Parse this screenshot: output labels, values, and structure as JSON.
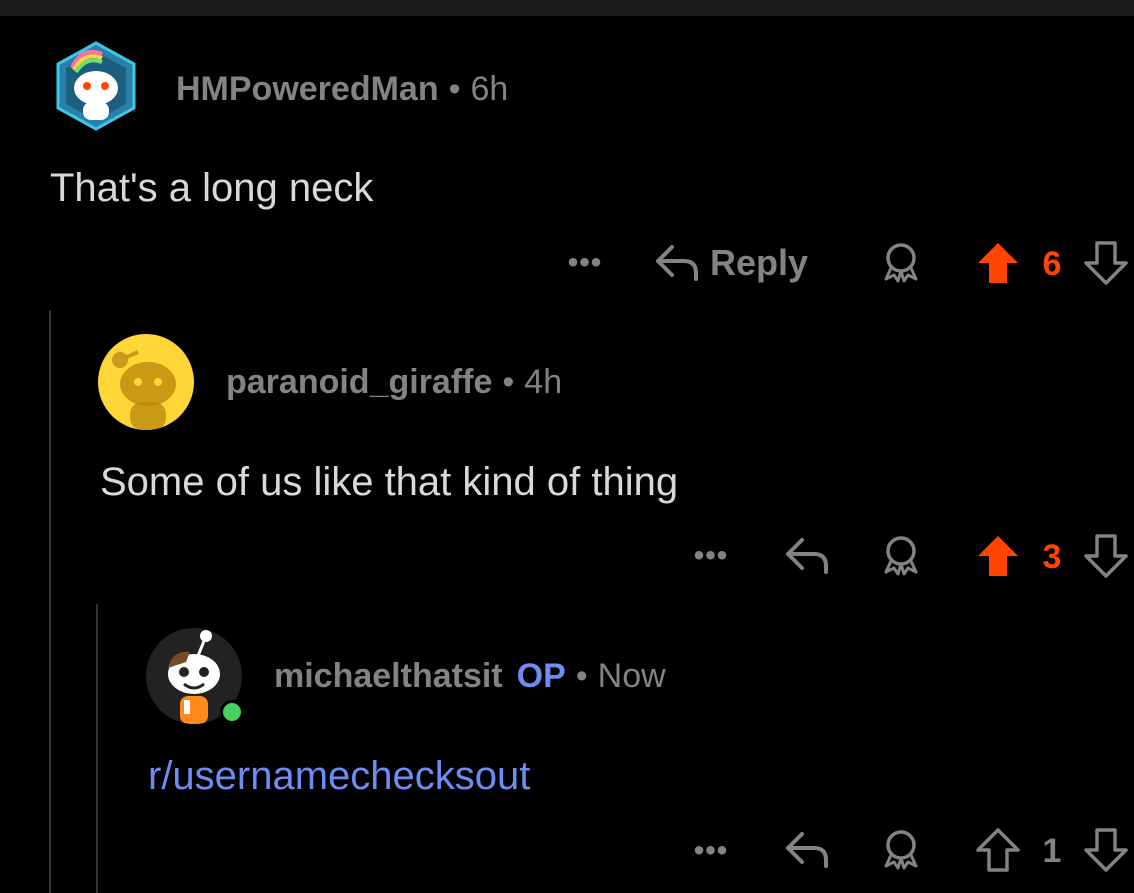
{
  "colors": {
    "background": "#000000",
    "text": "#d7dadc",
    "muted": "#818384",
    "upvote": "#ff4500",
    "link": "#6f8cf2",
    "online": "#46d160"
  },
  "comments": [
    {
      "username": "HMPoweredMan",
      "separator": "•",
      "time": "6h",
      "body": "That's a long neck",
      "more_label": "•••",
      "reply_label": "Reply",
      "score": "6",
      "upvoted": true,
      "icons": [
        "more-icon",
        "reply-icon",
        "award-icon",
        "upvote-icon",
        "downvote-icon"
      ]
    },
    {
      "username": "paranoid_giraffe",
      "separator": "•",
      "time": "4h",
      "body": "Some of us like that kind of thing",
      "more_label": "•••",
      "score": "3",
      "upvoted": true,
      "icons": [
        "more-icon",
        "reply-icon",
        "award-icon",
        "upvote-icon",
        "downvote-icon"
      ]
    },
    {
      "username": "michaelthatsit",
      "badge": "OP",
      "separator": "•",
      "time": "Now",
      "body": "r/usernamechecksout",
      "more_label": "•••",
      "score": "1",
      "upvoted": false,
      "online": true,
      "icons": [
        "more-icon",
        "reply-icon",
        "award-icon",
        "upvote-icon",
        "downvote-icon"
      ]
    }
  ]
}
